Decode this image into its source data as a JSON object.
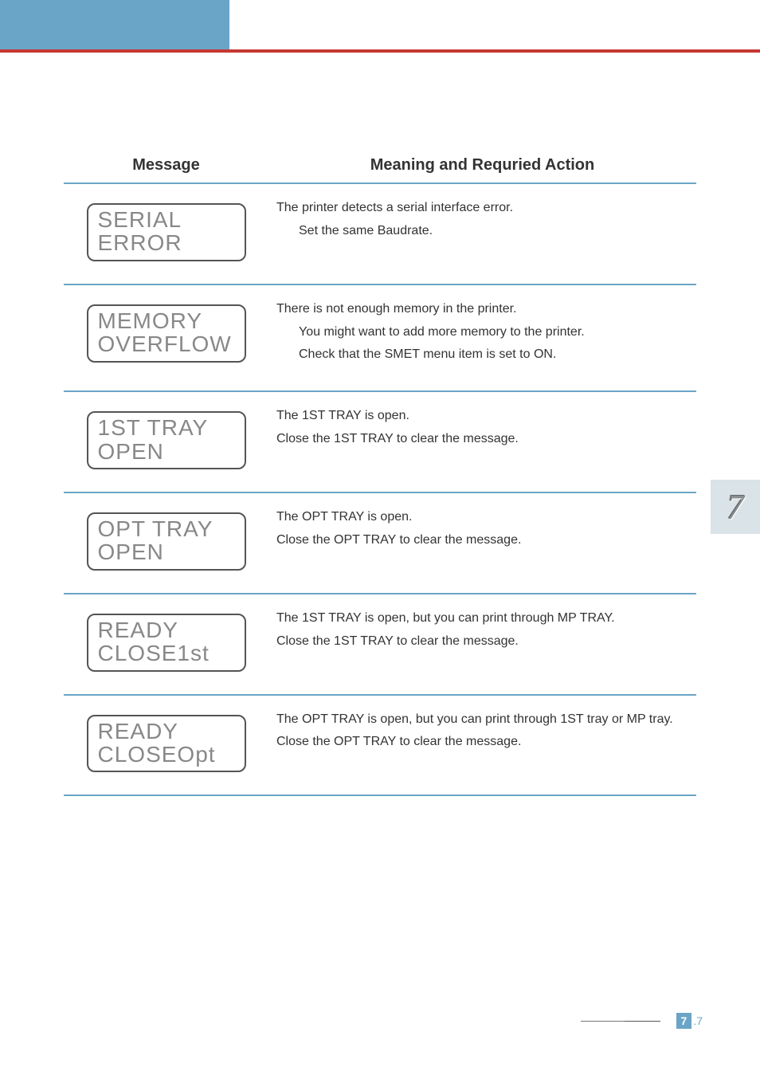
{
  "table": {
    "headers": {
      "message": "Message",
      "action": "Meaning and Requried Action"
    },
    "rows": [
      {
        "lcd": {
          "l1": "SERIAL",
          "l2": "ERROR"
        },
        "meaning": {
          "p1": "The printer detects a serial interface error.",
          "s1": "Set the same Baudrate."
        }
      },
      {
        "lcd": {
          "l1": "MEMORY",
          "l2": "OVERFLOW"
        },
        "meaning": {
          "p1": "There is not enough memory in the printer.",
          "s1": "You might want to add more memory to the printer.",
          "s2": "Check that the SMET menu item is set to ON."
        }
      },
      {
        "lcd": {
          "l1": "1ST TRAY",
          "l2": "OPEN"
        },
        "meaning": {
          "p1": "The 1ST TRAY is open.",
          "p2": "Close the 1ST TRAY to clear the message."
        }
      },
      {
        "lcd": {
          "l1": "OPT TRAY",
          "l2": "OPEN"
        },
        "meaning": {
          "p1": "The OPT TRAY is open.",
          "p2": "Close the OPT TRAY to clear the message."
        }
      },
      {
        "lcd": {
          "l1": "READY",
          "l2": "CLOSE1st"
        },
        "meaning": {
          "p1": "The 1ST TRAY is open, but you can print through MP TRAY.",
          "p2": "Close the 1ST TRAY to clear the message."
        }
      },
      {
        "lcd": {
          "l1": "READY",
          "l2": "CLOSEOpt"
        },
        "meaning": {
          "p1": "The OPT TRAY is open, but you can print through 1ST tray or MP tray.",
          "p2": "Close the OPT TRAY to clear the message."
        }
      }
    ]
  },
  "chapter": "7",
  "page": {
    "major": "7",
    "minor": ".7"
  }
}
